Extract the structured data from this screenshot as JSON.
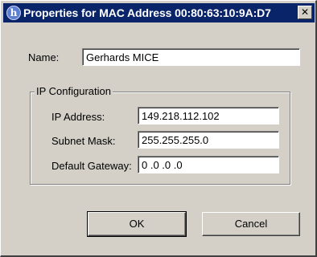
{
  "window": {
    "title": "Properties for MAC Address 00:80:63:10:9A:D7",
    "close_glyph": "✕",
    "title_icon_glyph": "h"
  },
  "name_field": {
    "label": "Name:",
    "value": "Gerhards MICE"
  },
  "ip_configuration": {
    "group_label": "IP Configuration",
    "ip_address": {
      "label": "IP Address:",
      "value": "149.218.112.102"
    },
    "subnet_mask": {
      "label": "Subnet Mask:",
      "value": "255.255.255.0"
    },
    "default_gateway": {
      "label": "Default Gateway:",
      "value": "0 .0 .0 .0"
    }
  },
  "buttons": {
    "ok_label": "OK",
    "cancel_label": "Cancel"
  },
  "icons": {
    "title_icon": "hirschmann-logo-icon",
    "close_icon": "close-icon"
  }
}
